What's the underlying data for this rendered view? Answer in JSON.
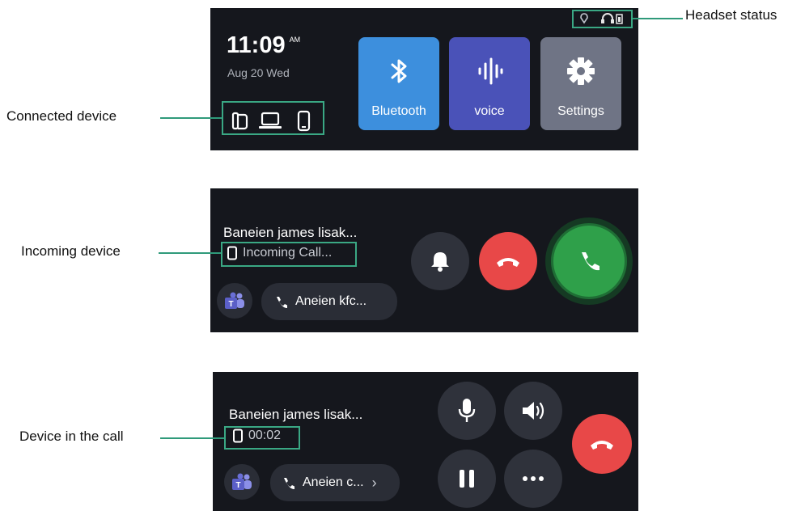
{
  "callouts": {
    "headset_status": "Headset status",
    "connected_device": "Connected device",
    "incoming_device": "Incoming device",
    "device_in_call": "Device in the call"
  },
  "home": {
    "time": "11:09",
    "ampm": "AM",
    "date": "Aug 20 Wed",
    "tiles": [
      {
        "label": "Bluetooth",
        "icon": "bluetooth-icon",
        "color": "#3d8fdd"
      },
      {
        "label": "voice",
        "icon": "voice-wave-icon",
        "color": "#4a52b8"
      },
      {
        "label": "Settings",
        "icon": "gear-icon",
        "color": "#6f7485"
      }
    ],
    "connected_devices": [
      "desk-phone-icon",
      "laptop-icon",
      "mobile-icon"
    ]
  },
  "incoming": {
    "caller": "Baneien james lisak...",
    "status": "Incoming Call...",
    "second_call": "Aneien kfc...",
    "app_icon": "teams-icon"
  },
  "in_call": {
    "caller": "Baneien james lisak...",
    "timer": "00:02",
    "second_call": "Aneien c...",
    "chevron": "›",
    "app_icon": "teams-icon"
  },
  "colors": {
    "panel_bg": "#15171d",
    "accent_line": "#2f9a7a",
    "decline_red": "#e84848",
    "answer_green": "#2fa04a",
    "button_gray": "#2f323b"
  }
}
